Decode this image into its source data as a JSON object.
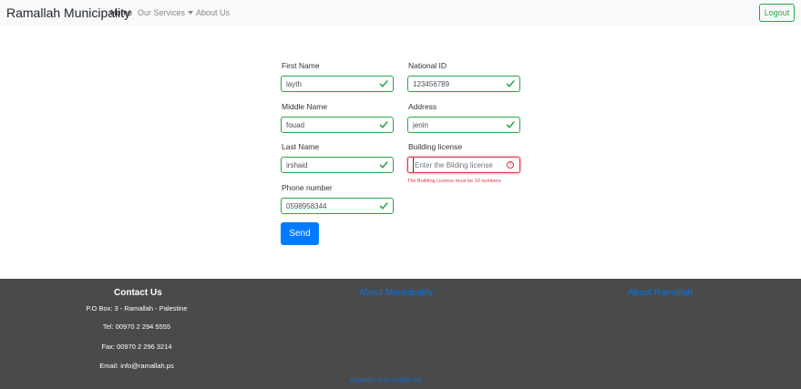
{
  "navbar": {
    "brand": "Ramallah Municipality",
    "links": [
      {
        "label": "Home"
      },
      {
        "label": "Our Services"
      },
      {
        "label": "About Us"
      }
    ],
    "logout_label": "Logout"
  },
  "form": {
    "first_name": {
      "label": "First Name",
      "value": "layth"
    },
    "middle_name": {
      "label": "Middle Name",
      "value": "fouad"
    },
    "last_name": {
      "label": "Last Name",
      "value": "irshaid"
    },
    "phone": {
      "label": "Phone number",
      "value": "0598958344"
    },
    "national_id": {
      "label": "National ID",
      "value": "123456789"
    },
    "address": {
      "label": "Address",
      "value": "jenin"
    },
    "building_license": {
      "label": "Building license",
      "value": "",
      "placeholder": "Enter the Bilding license",
      "error": "The Building License must be 10 numbers"
    },
    "send_label": "Send"
  },
  "footer": {
    "contact_title": "Contact Us",
    "contact_lines": [
      "P.O Box: 3 - Ramallah - Palestine",
      "Tel: 00970 2 294 5555",
      "Fax: 00970 2 296 3214",
      "Email: info@ramallah.ps"
    ],
    "about_municipality": "About Municipality",
    "about_ramallah": "About Ramallah",
    "copyright": "Copyright 2021 AXSOS AG"
  },
  "colors": {
    "valid": "#28a745",
    "invalid": "#dc3545",
    "primary": "#007bff",
    "footer_bg": "#4a4a4a",
    "footer_link": "#0a74e6"
  },
  "icons": {
    "valid": "check-icon",
    "invalid": "exclamation-circle-icon",
    "dropdown": "caret-down-icon"
  }
}
